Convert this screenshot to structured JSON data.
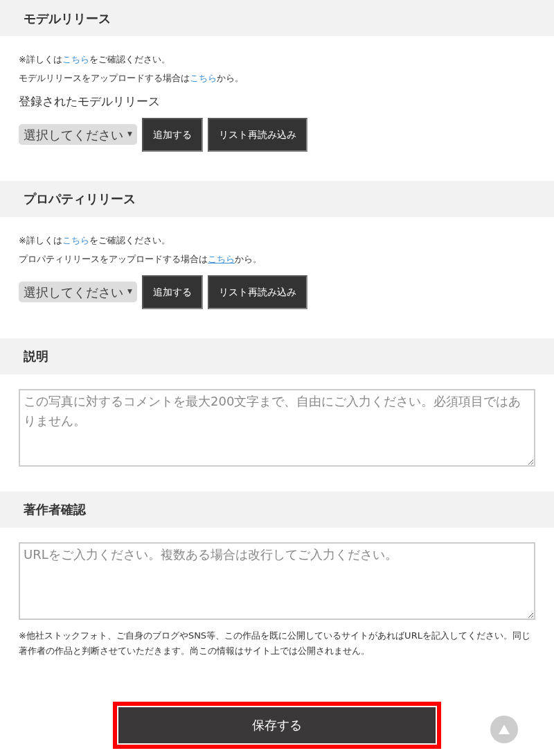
{
  "sections": [
    {
      "kind": "release",
      "title": "モデルリリース",
      "lines": [
        {
          "before": "※詳しくは",
          "link": "こちら",
          "after": "をご確認ください。",
          "underlined": false
        },
        {
          "before": "モデルリリースをアップロードする場合は",
          "link": "こちら",
          "after": "から。",
          "underlined": false
        }
      ],
      "subtitle": "登録されたモデルリリース",
      "select": "選択してください",
      "arrow": "▼",
      "buttons": [
        "追加する",
        "リスト再読み込み"
      ]
    },
    {
      "kind": "release",
      "title": "プロパティリリース",
      "lines": [
        {
          "before": "※詳しくは",
          "link": "こちら",
          "after": "をご確認ください。",
          "underlined": false
        },
        {
          "before": "プロパティリリースをアップロードする場合は",
          "link": "こちら",
          "after": "から。",
          "underlined": true
        }
      ],
      "select": "選択してください",
      "arrow": "▼",
      "buttons": [
        "追加する",
        "リスト再読み込み"
      ]
    },
    {
      "kind": "textarea",
      "title": "説明",
      "placeholder": "この写真に対するコメントを最大200文字まで、自由にご入力ください。必須項目ではありません。"
    },
    {
      "kind": "textarea",
      "title": "著作者確認",
      "placeholder": "URLをご入力ください。複数ある場合は改行してご入力ください。",
      "note": "※他社ストックフォト、ご自身のブログやSNS等、この作品を既に公開しているサイトがあればURLを記入してください。同じ著作者の作品と判断させていただきます。尚この情報はサイト上では公開されません。"
    }
  ],
  "save": {
    "label": "保存する",
    "highlighted": true
  }
}
